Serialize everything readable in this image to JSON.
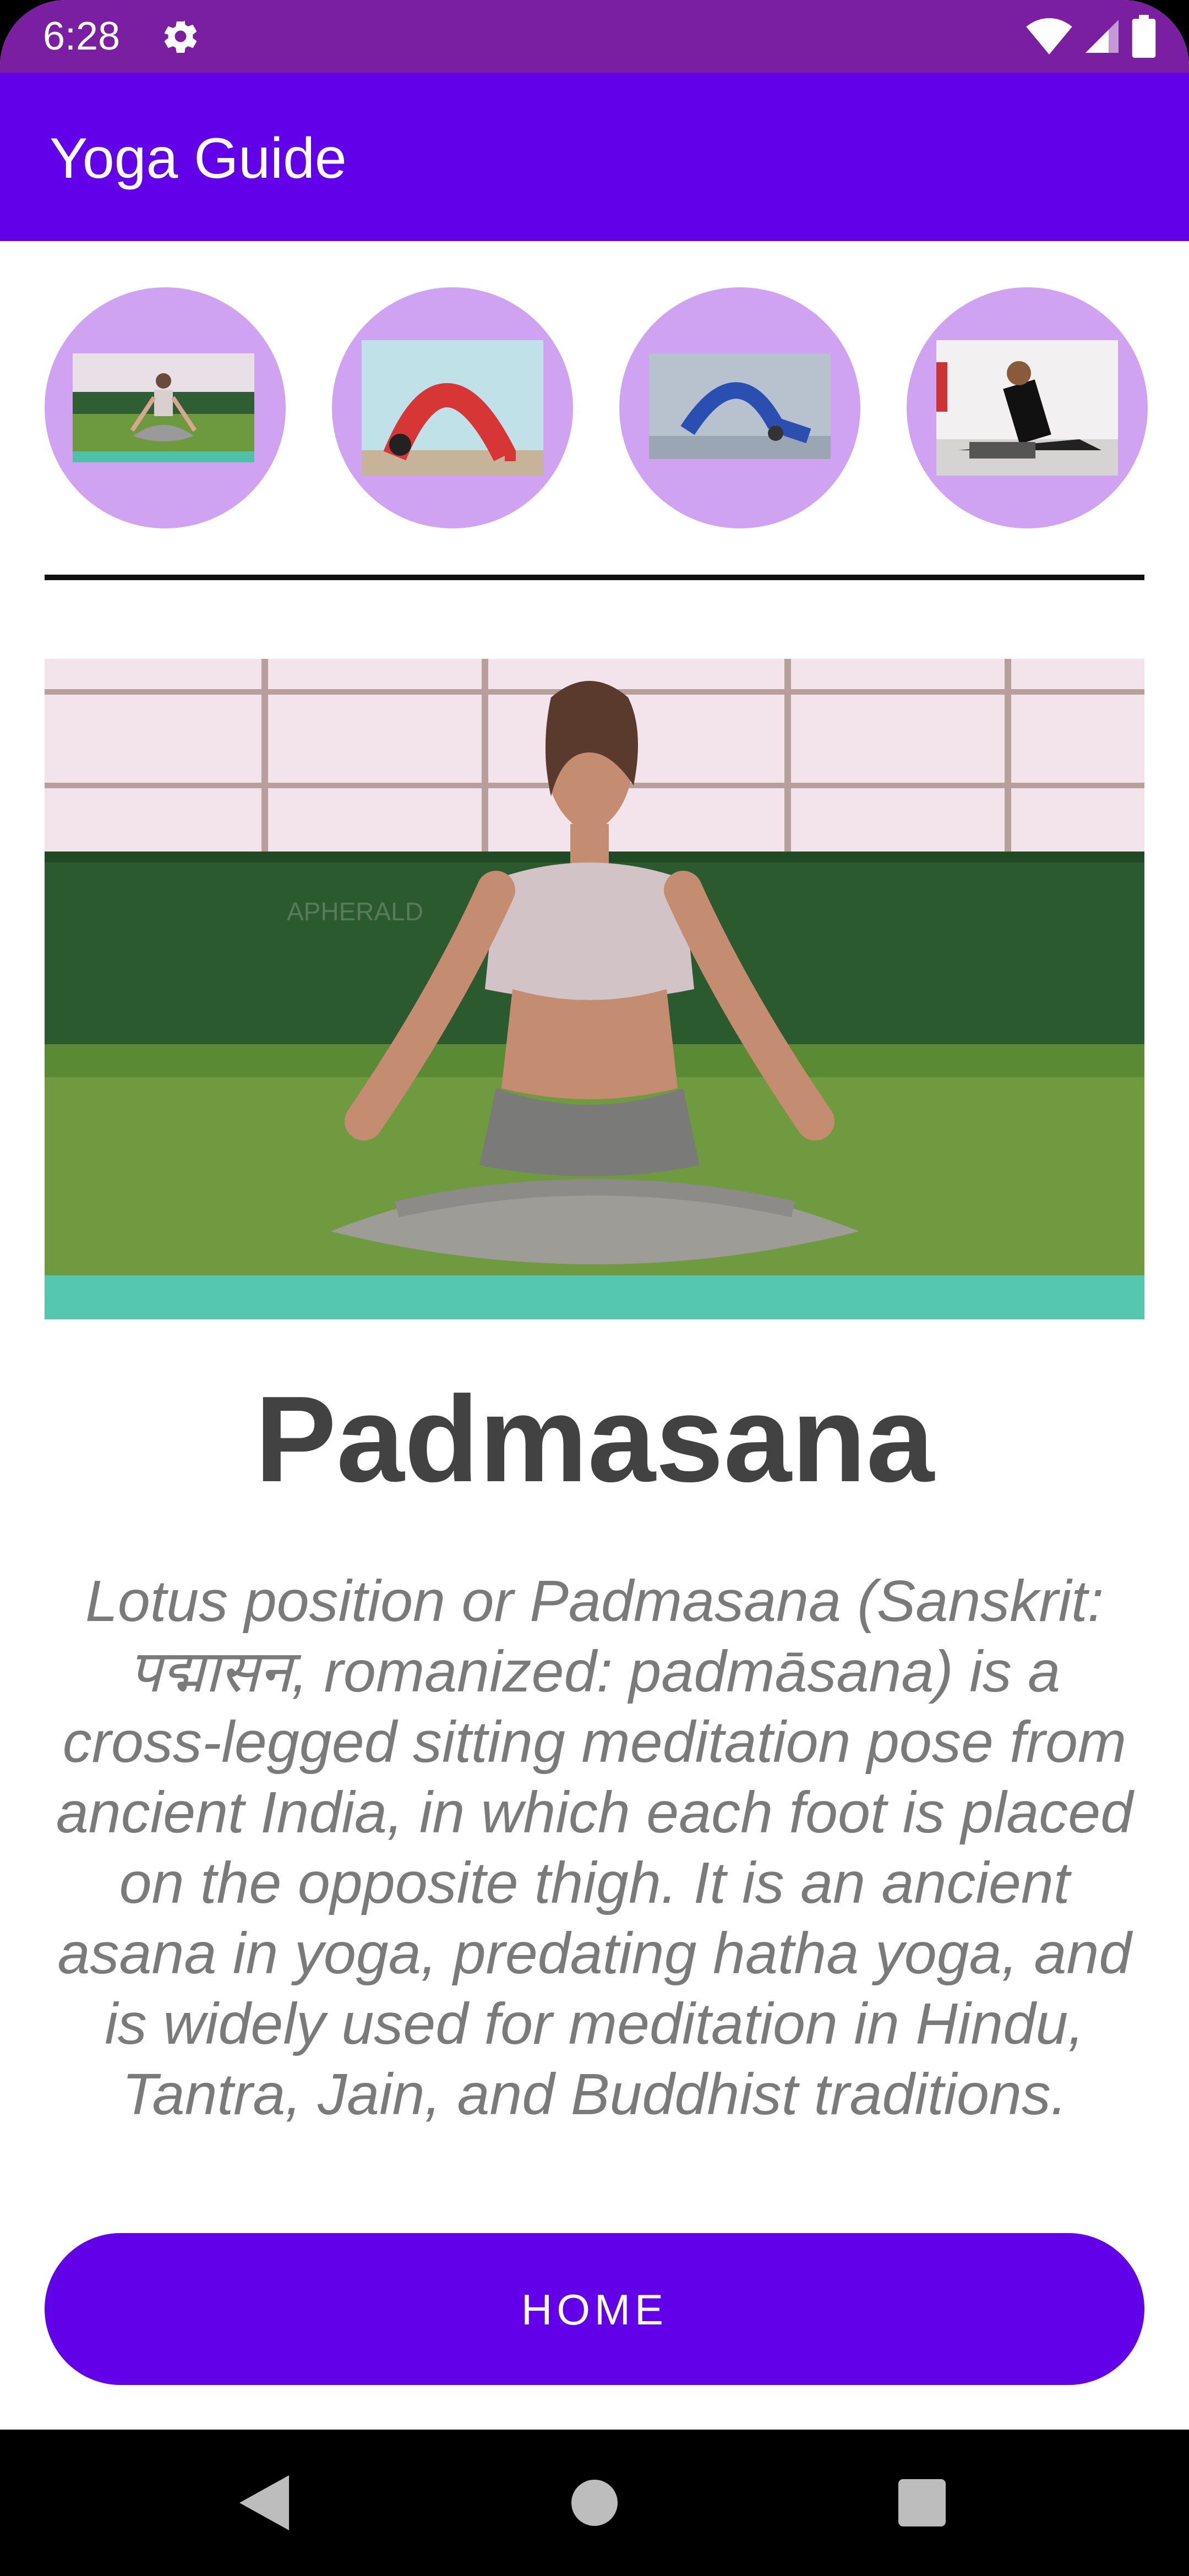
{
  "status_bar": {
    "time": "6:28",
    "icons": [
      "gear-icon",
      "wifi-icon",
      "signal-icon",
      "battery-icon"
    ]
  },
  "app_bar": {
    "title": "Yoga Guide"
  },
  "thumbnails": [
    {
      "name": "Padmasana"
    },
    {
      "name": "Wheel pose"
    },
    {
      "name": "Plow pose"
    },
    {
      "name": "Cobra pose"
    }
  ],
  "pose": {
    "title": "Padmasana",
    "description": "Lotus position or Padmasana (Sanskrit: पद्मासन, romanized: padmāsana) is a cross-legged sitting meditation pose from ancient India, in which each foot is placed on the opposite thigh. It is an ancient asana in yoga, predating hatha yoga, and is widely used for meditation in Hindu, Tantra, Jain, and Buddhist traditions.",
    "image_watermark": "APHERALD"
  },
  "actions": {
    "home_label": "HOME"
  },
  "nav": {
    "back": "back-icon",
    "home": "home-circle-icon",
    "recents": "recents-square-icon"
  },
  "colors": {
    "status_bar": "#7a1fa2",
    "primary": "#6200ea",
    "thumb_bg": "#cfa3f1",
    "title_text": "#424242",
    "desc_text": "#7a7a7a"
  }
}
